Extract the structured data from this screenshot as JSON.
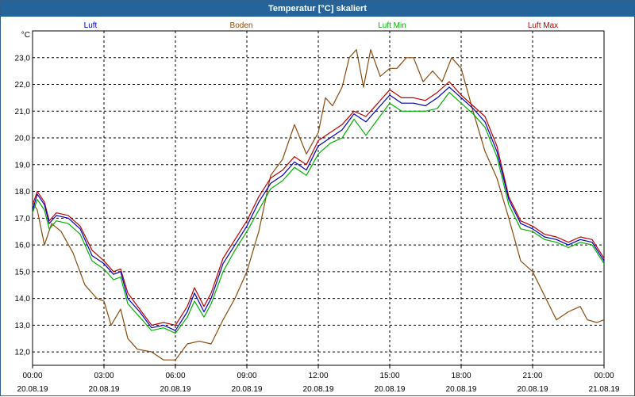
{
  "window": {
    "title": "Temperatur [°C] skaliert"
  },
  "colors": {
    "background": "#ffffff",
    "title_bar": "#24649a",
    "grid": "#000000",
    "luft": "#0000c0",
    "boden": "#8b4a0c",
    "luft_min": "#00b000",
    "luft_max": "#c00000"
  },
  "chart_data": {
    "type": "line",
    "title": "Temperatur [°C] skaliert",
    "ylabel": "°C",
    "xlabel": "",
    "ylim": [
      11.5,
      24.0
    ],
    "xlim": [
      0,
      24
    ],
    "grid": true,
    "legend_position": "top",
    "y_ticks": [
      "12,0",
      "13,0",
      "14,0",
      "15,0",
      "16,0",
      "17,0",
      "18,0",
      "19,0",
      "20,0",
      "21,0",
      "22,0",
      "23,0"
    ],
    "y_tick_values": [
      12,
      13,
      14,
      15,
      16,
      17,
      18,
      19,
      20,
      21,
      22,
      23
    ],
    "x_ticks": [
      {
        "time": "00:00",
        "date": "20.08.19"
      },
      {
        "time": "03:00",
        "date": "20.08.19"
      },
      {
        "time": "06:00",
        "date": "20.08.19"
      },
      {
        "time": "09:00",
        "date": "20.08.19"
      },
      {
        "time": "12:00",
        "date": "20.08.19"
      },
      {
        "time": "15:00",
        "date": "20.08.19"
      },
      {
        "time": "18:00",
        "date": "20.08.19"
      },
      {
        "time": "21:00",
        "date": "20.08.19"
      },
      {
        "time": "00:00",
        "date": "21.08.19"
      }
    ],
    "x_tick_values": [
      0,
      3,
      6,
      9,
      12,
      15,
      18,
      21,
      24
    ],
    "series": [
      {
        "name": "Luft",
        "color": "#0000c0",
        "points": [
          [
            0,
            17.3
          ],
          [
            0.2,
            17.9
          ],
          [
            0.5,
            17.5
          ],
          [
            0.7,
            16.8
          ],
          [
            1.0,
            17.1
          ],
          [
            1.5,
            17.0
          ],
          [
            2.0,
            16.6
          ],
          [
            2.5,
            15.6
          ],
          [
            3.0,
            15.3
          ],
          [
            3.4,
            14.9
          ],
          [
            3.7,
            15.0
          ],
          [
            4.0,
            14.0
          ],
          [
            4.5,
            13.5
          ],
          [
            5.0,
            12.9
          ],
          [
            5.5,
            13.0
          ],
          [
            6.0,
            12.8
          ],
          [
            6.5,
            13.5
          ],
          [
            6.8,
            14.2
          ],
          [
            7.2,
            13.5
          ],
          [
            7.5,
            14.0
          ],
          [
            8.0,
            15.3
          ],
          [
            8.5,
            16.0
          ],
          [
            9.0,
            16.7
          ],
          [
            9.5,
            17.6
          ],
          [
            10.0,
            18.3
          ],
          [
            10.5,
            18.6
          ],
          [
            11.0,
            19.1
          ],
          [
            11.5,
            18.8
          ],
          [
            12.0,
            19.7
          ],
          [
            12.5,
            20.0
          ],
          [
            13.0,
            20.3
          ],
          [
            13.5,
            20.9
          ],
          [
            14.0,
            20.6
          ],
          [
            14.5,
            21.1
          ],
          [
            15.0,
            21.6
          ],
          [
            15.5,
            21.3
          ],
          [
            16.0,
            21.3
          ],
          [
            16.5,
            21.2
          ],
          [
            17.0,
            21.5
          ],
          [
            17.5,
            21.9
          ],
          [
            18.0,
            21.5
          ],
          [
            18.5,
            21.1
          ],
          [
            19.0,
            20.6
          ],
          [
            19.5,
            19.5
          ],
          [
            20.0,
            17.7
          ],
          [
            20.5,
            16.8
          ],
          [
            21.0,
            16.6
          ],
          [
            21.5,
            16.3
          ],
          [
            22.0,
            16.2
          ],
          [
            22.5,
            16.0
          ],
          [
            23.0,
            16.2
          ],
          [
            23.5,
            16.1
          ],
          [
            24.0,
            15.4
          ]
        ]
      },
      {
        "name": "Boden",
        "color": "#8b4a0c",
        "points": [
          [
            0,
            17.6
          ],
          [
            0.2,
            17.3
          ],
          [
            0.5,
            16.0
          ],
          [
            0.8,
            16.8
          ],
          [
            1.2,
            16.5
          ],
          [
            1.7,
            15.7
          ],
          [
            2.2,
            14.5
          ],
          [
            2.7,
            14.0
          ],
          [
            3.0,
            13.9
          ],
          [
            3.3,
            13.0
          ],
          [
            3.7,
            13.6
          ],
          [
            4.0,
            12.5
          ],
          [
            4.4,
            12.1
          ],
          [
            5.0,
            12.0
          ],
          [
            5.5,
            11.7
          ],
          [
            6.0,
            11.7
          ],
          [
            6.5,
            12.3
          ],
          [
            7.0,
            12.4
          ],
          [
            7.5,
            12.3
          ],
          [
            8.0,
            13.2
          ],
          [
            8.5,
            14.0
          ],
          [
            9.0,
            15.0
          ],
          [
            9.5,
            16.5
          ],
          [
            10.0,
            18.6
          ],
          [
            10.5,
            19.2
          ],
          [
            11.0,
            20.5
          ],
          [
            11.5,
            19.4
          ],
          [
            12.0,
            20.2
          ],
          [
            12.3,
            21.5
          ],
          [
            12.6,
            21.2
          ],
          [
            13.0,
            21.9
          ],
          [
            13.3,
            23.0
          ],
          [
            13.6,
            23.3
          ],
          [
            13.9,
            21.9
          ],
          [
            14.2,
            23.3
          ],
          [
            14.6,
            22.3
          ],
          [
            15.0,
            22.6
          ],
          [
            15.3,
            22.6
          ],
          [
            15.7,
            23.0
          ],
          [
            16.0,
            23.0
          ],
          [
            16.4,
            22.1
          ],
          [
            16.8,
            22.5
          ],
          [
            17.2,
            22.1
          ],
          [
            17.6,
            23.0
          ],
          [
            18.0,
            22.6
          ],
          [
            18.5,
            21.0
          ],
          [
            19.0,
            19.5
          ],
          [
            19.5,
            18.5
          ],
          [
            20.0,
            17.0
          ],
          [
            20.5,
            15.4
          ],
          [
            21.0,
            15.0
          ],
          [
            21.5,
            14.1
          ],
          [
            22.0,
            13.2
          ],
          [
            22.5,
            13.5
          ],
          [
            23.0,
            13.7
          ],
          [
            23.3,
            13.2
          ],
          [
            23.7,
            13.1
          ],
          [
            24.0,
            13.2
          ]
        ]
      },
      {
        "name": "Luft Min",
        "color": "#00b000",
        "points": [
          [
            0,
            17.2
          ],
          [
            0.2,
            17.7
          ],
          [
            0.5,
            17.3
          ],
          [
            0.7,
            16.6
          ],
          [
            1.0,
            16.9
          ],
          [
            1.5,
            16.8
          ],
          [
            2.0,
            16.4
          ],
          [
            2.5,
            15.4
          ],
          [
            3.0,
            15.1
          ],
          [
            3.4,
            14.7
          ],
          [
            3.7,
            14.8
          ],
          [
            4.0,
            13.8
          ],
          [
            4.5,
            13.3
          ],
          [
            5.0,
            12.8
          ],
          [
            5.5,
            12.9
          ],
          [
            6.0,
            12.7
          ],
          [
            6.5,
            13.3
          ],
          [
            6.8,
            13.9
          ],
          [
            7.2,
            13.3
          ],
          [
            7.5,
            13.8
          ],
          [
            8.0,
            15.0
          ],
          [
            8.5,
            15.8
          ],
          [
            9.0,
            16.5
          ],
          [
            9.5,
            17.3
          ],
          [
            10.0,
            18.1
          ],
          [
            10.5,
            18.4
          ],
          [
            11.0,
            18.9
          ],
          [
            11.5,
            18.6
          ],
          [
            12.0,
            19.4
          ],
          [
            12.5,
            19.8
          ],
          [
            13.0,
            20.0
          ],
          [
            13.5,
            20.7
          ],
          [
            14.0,
            20.1
          ],
          [
            14.5,
            20.7
          ],
          [
            15.0,
            21.3
          ],
          [
            15.5,
            21.0
          ],
          [
            16.0,
            21.0
          ],
          [
            16.5,
            21.0
          ],
          [
            17.0,
            21.1
          ],
          [
            17.5,
            21.7
          ],
          [
            18.0,
            21.3
          ],
          [
            18.5,
            20.9
          ],
          [
            19.0,
            20.4
          ],
          [
            19.5,
            19.3
          ],
          [
            20.0,
            17.5
          ],
          [
            20.5,
            16.6
          ],
          [
            21.0,
            16.5
          ],
          [
            21.5,
            16.2
          ],
          [
            22.0,
            16.1
          ],
          [
            22.5,
            15.9
          ],
          [
            23.0,
            16.1
          ],
          [
            23.5,
            16.0
          ],
          [
            24.0,
            15.3
          ]
        ]
      },
      {
        "name": "Luft Max",
        "color": "#c00000",
        "points": [
          [
            0,
            17.5
          ],
          [
            0.2,
            18.0
          ],
          [
            0.5,
            17.6
          ],
          [
            0.7,
            16.9
          ],
          [
            1.0,
            17.2
          ],
          [
            1.5,
            17.1
          ],
          [
            2.0,
            16.7
          ],
          [
            2.5,
            15.8
          ],
          [
            3.0,
            15.4
          ],
          [
            3.4,
            15.0
          ],
          [
            3.7,
            15.1
          ],
          [
            4.0,
            14.2
          ],
          [
            4.5,
            13.6
          ],
          [
            5.0,
            13.0
          ],
          [
            5.5,
            13.1
          ],
          [
            6.0,
            13.0
          ],
          [
            6.5,
            13.7
          ],
          [
            6.8,
            14.4
          ],
          [
            7.2,
            13.7
          ],
          [
            7.5,
            14.2
          ],
          [
            8.0,
            15.5
          ],
          [
            8.5,
            16.2
          ],
          [
            9.0,
            16.9
          ],
          [
            9.5,
            17.8
          ],
          [
            10.0,
            18.5
          ],
          [
            10.5,
            18.8
          ],
          [
            11.0,
            19.3
          ],
          [
            11.5,
            19.0
          ],
          [
            12.0,
            19.9
          ],
          [
            12.5,
            20.2
          ],
          [
            13.0,
            20.5
          ],
          [
            13.5,
            21.0
          ],
          [
            14.0,
            20.8
          ],
          [
            14.5,
            21.3
          ],
          [
            15.0,
            21.8
          ],
          [
            15.5,
            21.5
          ],
          [
            16.0,
            21.5
          ],
          [
            16.5,
            21.4
          ],
          [
            17.0,
            21.7
          ],
          [
            17.5,
            22.1
          ],
          [
            18.0,
            21.6
          ],
          [
            18.5,
            21.2
          ],
          [
            19.0,
            20.8
          ],
          [
            19.5,
            19.7
          ],
          [
            20.0,
            17.8
          ],
          [
            20.5,
            16.9
          ],
          [
            21.0,
            16.7
          ],
          [
            21.5,
            16.4
          ],
          [
            22.0,
            16.3
          ],
          [
            22.5,
            16.1
          ],
          [
            23.0,
            16.3
          ],
          [
            23.5,
            16.2
          ],
          [
            24.0,
            15.5
          ]
        ]
      }
    ]
  }
}
